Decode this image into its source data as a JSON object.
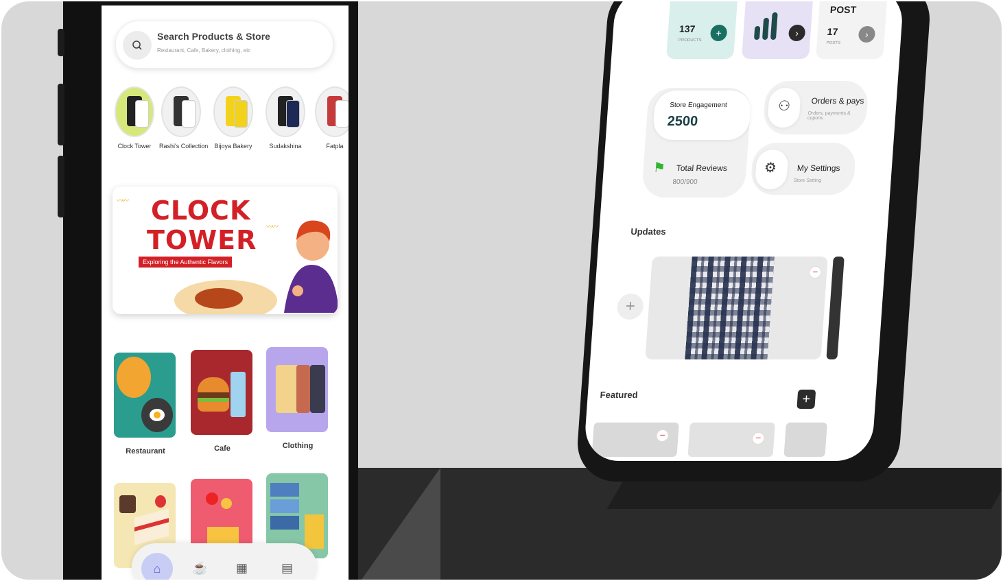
{
  "left_phone": {
    "search": {
      "title": "Search Products & Store",
      "placeholder": "Restaurant, Cafe, Bakery, clothing, etc",
      "icon": "search-icon"
    },
    "stores": [
      {
        "label": "Clock Tower"
      },
      {
        "label": "Rashi's Collection"
      },
      {
        "label": "Bijoya Bakery"
      },
      {
        "label": "Sudakshina"
      },
      {
        "label": "Fatpla"
      }
    ],
    "banner": {
      "title_line1": "CLOCK",
      "title_line2": "TOWER",
      "tagline": "Exploring the Authentic Flavors",
      "accent": "#d32026"
    },
    "categories": [
      {
        "label": "Restaurant",
        "color": "#2a9d8f"
      },
      {
        "label": "Cafe",
        "color": "#a8282e"
      },
      {
        "label": "Clothing",
        "color": "#b7a6ec"
      },
      {
        "label": "",
        "color": "#f4e7b3"
      },
      {
        "label": "",
        "color": "#ef5b6f"
      },
      {
        "label": "",
        "color": "#86c7a7"
      }
    ],
    "tabbar": {
      "items": [
        "home-icon",
        "cafe-icon",
        "grid-icon",
        "orders-icon"
      ]
    }
  },
  "right_phone": {
    "stats": [
      {
        "value": "137",
        "caption": "PRODUCTS"
      },
      {
        "value": "",
        "caption": ""
      },
      {
        "heading": "POST",
        "value": "17",
        "caption": "POSTS"
      }
    ],
    "engagement": {
      "label": "Store Engagement",
      "value": "2500",
      "color": "#1a3f45"
    },
    "orders": {
      "title": "Orders & pays",
      "subtitle": "Orders, payments & cupons"
    },
    "reviews": {
      "title": "Total Reviews",
      "value": "800/900"
    },
    "settings": {
      "title": "My Settings",
      "subtitle": "Store Setting"
    },
    "updates_title": "Updates",
    "featured_title": "Featured"
  }
}
